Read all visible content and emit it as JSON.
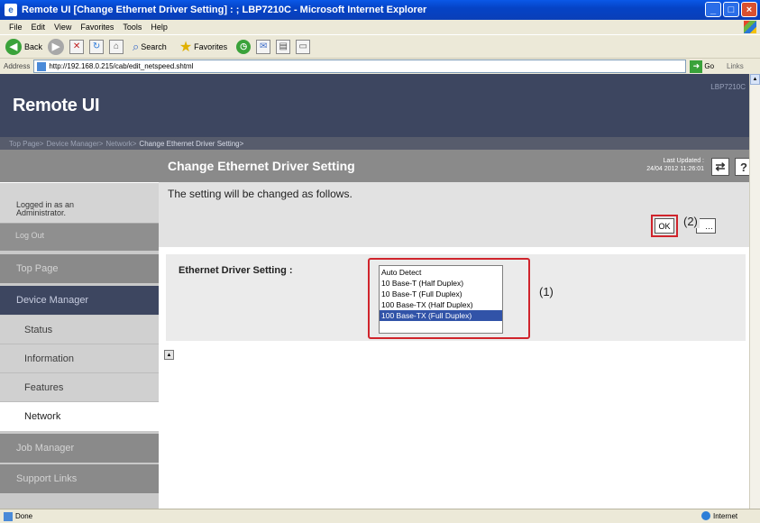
{
  "window": {
    "title": "Remote UI [Change Ethernet Driver Setting] : ; LBP7210C - Microsoft Internet Explorer",
    "controls": [
      "_",
      "□",
      "X"
    ]
  },
  "menubar": {
    "items": [
      "File",
      "Edit",
      "View",
      "Favorites",
      "Tools",
      "Help"
    ]
  },
  "toolbar": {
    "back_label": "Back",
    "search_label": "Search",
    "favorites_label": "Favorites"
  },
  "addressbar": {
    "label": "Address",
    "url": "http://192.168.0.215/cab/edit_netspeed.shtml",
    "go_label": "Go",
    "links_label": "Links"
  },
  "header": {
    "brand": "Remote UI",
    "model": "LBP7210C"
  },
  "breadcrumb": {
    "items": [
      "Top Page>",
      "Device Manager>",
      "Network>",
      "Change Ethernet Driver Setting>"
    ]
  },
  "sidebar": {
    "login_text_1": "Logged in as an",
    "login_text_2": "Administrator.",
    "logout_label": "Log Out",
    "top_page": "Top Page",
    "device_manager": "Device Manager",
    "status": "Status",
    "information": "Information",
    "features": "Features",
    "network": "Network",
    "job_manager": "Job Manager",
    "support_links": "Support Links"
  },
  "content": {
    "title": "Change Ethernet Driver Setting",
    "last_updated_label": "Last Updated :",
    "last_updated_value": "24/04 2012 11:26:01",
    "refresh_icon": "refresh-icon",
    "help_label": "?",
    "message": "The setting will be changed as follows.",
    "ok_label": "OK",
    "cancel_label": "Cancel",
    "callout_ok": "(2)",
    "setting_label": "Ethernet Driver Setting :",
    "callout_list": "(1)",
    "options": [
      "Auto Detect",
      "10 Base-T (Half Duplex)",
      "10 Base-T (Full Duplex)",
      "100 Base-TX (Half Duplex)",
      "100 Base-TX (Full Duplex)"
    ],
    "selected_option": "100 Base-TX (Full Duplex)"
  },
  "statusbar": {
    "status": "Done",
    "zone": "Internet"
  },
  "colors": {
    "header_bg": "#3d4660",
    "sidebar_bg": "#c9c9c9",
    "highlight_red": "#d0242c",
    "selected_bg": "#3153a8"
  }
}
